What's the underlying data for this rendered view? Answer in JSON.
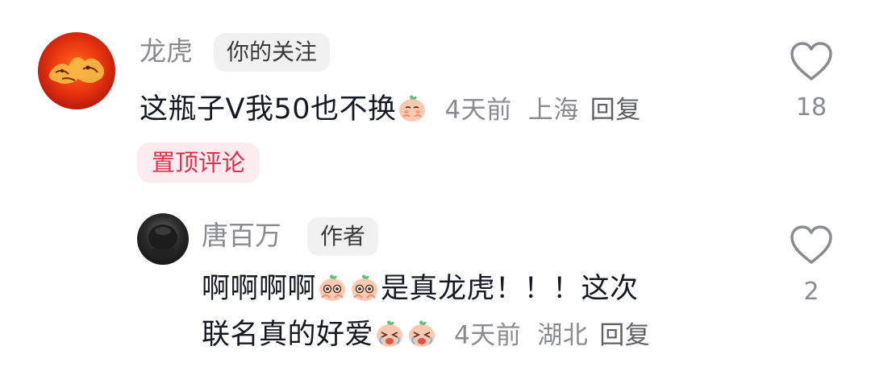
{
  "comments": [
    {
      "username": "龙虎",
      "tag": "你的关注",
      "text": "这瓶子V我50也不换",
      "emoji": "shy-peach-emoji",
      "time": "4天前",
      "location": "上海",
      "reply_label": "回复",
      "pinned_label": "置顶评论",
      "like_count": "18",
      "avatar": "tiger-dragon-avatar"
    },
    {
      "username": "唐百万",
      "tag": "作者",
      "text_part1": "啊啊啊啊",
      "text_part2": "是真龙虎！！！这次",
      "text_part3": "联名真的好爱",
      "emoji1": "starry-eyes-peach-emoji",
      "emoji2": "crying-peach-emoji",
      "time": "4天前",
      "location": "湖北",
      "reply_label": "回复",
      "like_count": "2",
      "avatar": "dark-avatar"
    }
  ],
  "colors": {
    "pinned_bg": "#fdecef",
    "pinned_text": "#e0304d",
    "meta_text": "#8a8b91",
    "tag_bg": "#f1f1f2"
  }
}
